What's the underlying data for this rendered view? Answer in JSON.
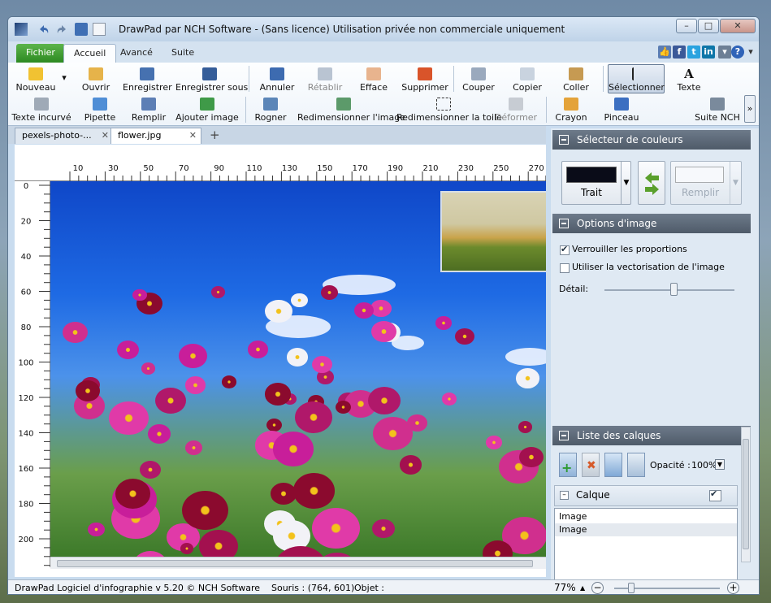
{
  "window": {
    "title": "DrawPad par NCH Software - (Sans licence) Utilisation privée non commerciale uniquement",
    "controls": {
      "minimize": "–",
      "maximize": "□",
      "close": "✕"
    }
  },
  "ribbon_tabs": [
    {
      "label": "Fichier"
    },
    {
      "label": "Accueil"
    },
    {
      "label": "Avancé"
    },
    {
      "label": "Suite"
    }
  ],
  "toolbar": {
    "row1": [
      {
        "label": "Nouveau",
        "icon": "new-file-icon"
      },
      {
        "label": "Ouvrir",
        "icon": "open-folder-icon"
      },
      {
        "label": "Enregistrer",
        "icon": "save-icon"
      },
      {
        "label": "Enregistrer sous",
        "icon": "save-as-icon"
      },
      {
        "label": "Annuler",
        "icon": "undo-icon"
      },
      {
        "label": "Rétablir",
        "icon": "redo-icon"
      },
      {
        "label": "Efface",
        "icon": "eraser-icon"
      },
      {
        "label": "Supprimer",
        "icon": "delete-icon"
      },
      {
        "label": "Couper",
        "icon": "cut-icon"
      },
      {
        "label": "Copier",
        "icon": "copy-icon"
      },
      {
        "label": "Coller",
        "icon": "paste-icon"
      },
      {
        "label": "Sélectionner",
        "icon": "select-cursor-icon"
      },
      {
        "label": "Texte",
        "icon": "text-icon"
      }
    ],
    "row2": [
      {
        "label": "Texte incurvé",
        "icon": "curved-text-icon"
      },
      {
        "label": "Pipette",
        "icon": "eyedropper-icon"
      },
      {
        "label": "Remplir",
        "icon": "fill-bucket-icon"
      },
      {
        "label": "Ajouter image",
        "icon": "add-image-icon"
      },
      {
        "label": "Rogner",
        "icon": "crop-icon"
      },
      {
        "label": "Redimensionner l'image",
        "icon": "resize-image-icon"
      },
      {
        "label": "Redimensionner la toile",
        "icon": "resize-canvas-icon"
      },
      {
        "label": "Déformer",
        "icon": "distort-icon"
      },
      {
        "label": "Crayon",
        "icon": "pencil-icon"
      },
      {
        "label": "Pinceau",
        "icon": "brush-icon"
      },
      {
        "label": "Suite NCH",
        "icon": "nch-suite-icon"
      }
    ],
    "more": "»"
  },
  "doc_tabs": [
    {
      "label": "pexels-photo-..."
    },
    {
      "label": "flower.jpg"
    }
  ],
  "doc_tab_close": "✕",
  "new_tab": "+",
  "rulers": {
    "top": [
      "10",
      "30",
      "50",
      "70",
      "90",
      "110",
      "130",
      "150",
      "170",
      "190",
      "210",
      "230",
      "250",
      "270"
    ],
    "left": [
      "0",
      "20",
      "40",
      "60",
      "80",
      "100",
      "120",
      "140",
      "160",
      "180",
      "200"
    ]
  },
  "panels": {
    "color_picker": {
      "title": "Sélecteur de couleurs",
      "stroke_label": "Trait",
      "fill_label": "Remplir",
      "stroke_color": "#0a0c18",
      "fill_color": "#ffffff"
    },
    "image_options": {
      "title": "Options d'image",
      "lock_ratio": "Verrouiller les proportions",
      "lock_ratio_checked": true,
      "vectorize": "Utiliser la vectorisation de l'image",
      "vectorize_checked": false,
      "detail_label": "Détail:",
      "detail_value": 0.53
    },
    "layers": {
      "title": "Liste des calques",
      "opacity_label": "Opacité :",
      "opacity_value": "100%",
      "layer_group": "Calque",
      "items": [
        "Image",
        "Image"
      ]
    }
  },
  "status": {
    "app": "DrawPad Logiciel d'infographie v 5.20 © NCH Software",
    "mouse": "Souris : (764, 601)",
    "object": "Objet :",
    "zoom": "77%"
  }
}
